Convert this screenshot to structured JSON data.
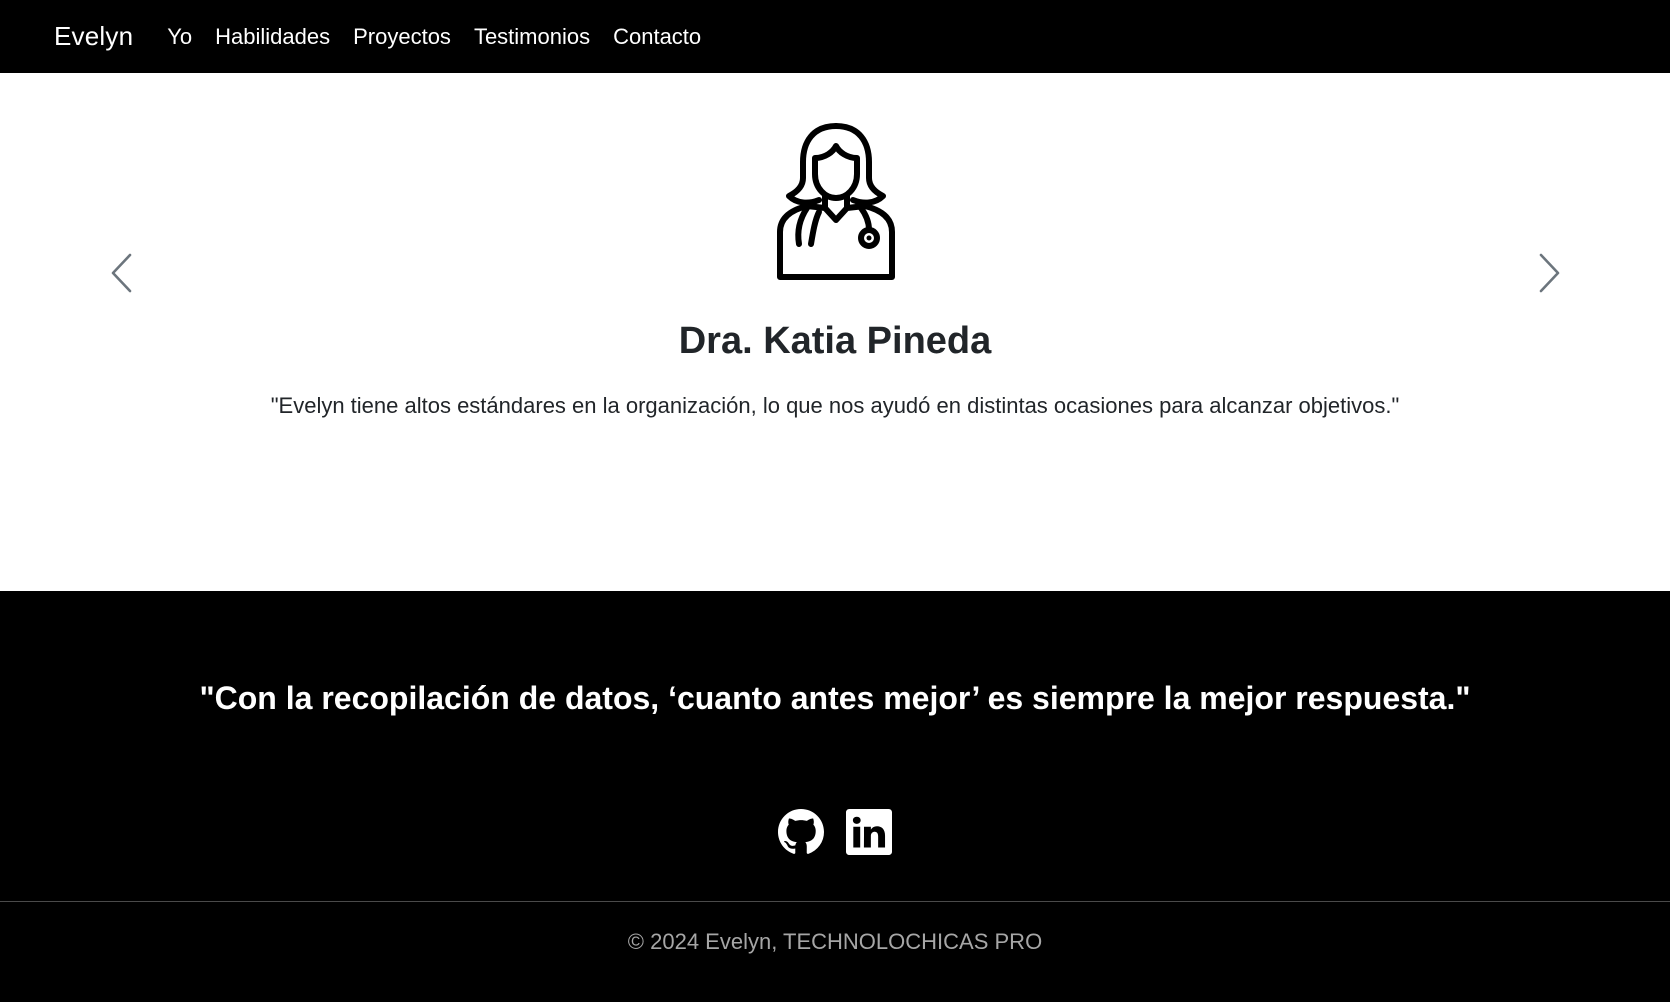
{
  "navbar": {
    "brand": "Evelyn",
    "links": [
      "Yo",
      "Habilidades",
      "Proyectos",
      "Testimonios",
      "Contacto"
    ]
  },
  "testimonials": {
    "avatar_icon": "female-doctor-icon",
    "prev_icon": "chevron-left-icon",
    "next_icon": "chevron-right-icon",
    "active_slide": {
      "name": "Dra. Katia Pineda",
      "quote": "\"Evelyn tiene altos estándares en la organización, lo que nos ayudó en distintas ocasiones para alcanzar objetivos.\""
    }
  },
  "footer": {
    "quote": "\"Con la recopilación de datos, ‘cuanto antes mejor’ es siempre la mejor respuesta.\"",
    "social": [
      {
        "icon": "github-icon"
      },
      {
        "icon": "linkedin-icon"
      }
    ],
    "copyright": "© 2024 Evelyn, TECHNOLOCHICAS PRO"
  },
  "colors": {
    "nav_bg": "#000000",
    "footer_bg": "#000000",
    "text_dark": "#212529",
    "text_muted": "#a6a6a6",
    "control": "#6c757d"
  }
}
